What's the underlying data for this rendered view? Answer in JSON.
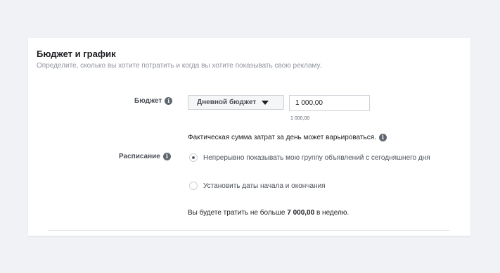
{
  "section": {
    "title": "Бюджет и график",
    "subtitle": "Определите, сколько вы хотите потратить и когда вы хотите показывать свою рекламу."
  },
  "budget": {
    "label": "Бюджет",
    "type_selected": "Дневной бюджет",
    "value": "1 000,00",
    "hint": "1 000,00",
    "actual_note": "Фактическая сумма затрат за день может варьироваться."
  },
  "schedule": {
    "label": "Расписание",
    "options": [
      {
        "label": "Непрерывно показывать мою группу объявлений с сегодняшнего дня",
        "checked": true
      },
      {
        "label": "Установить даты начала и окончания",
        "checked": false
      }
    ]
  },
  "spend": {
    "prefix": "Вы будете тратить не больше",
    "amount": "7 000,00",
    "suffix": "в неделю."
  },
  "icons": {
    "info": "info-icon",
    "dropdown": "caret-down-icon"
  }
}
